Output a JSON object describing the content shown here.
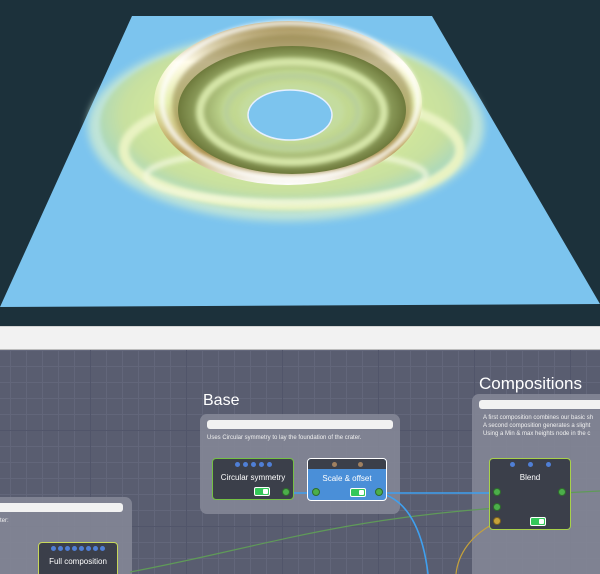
{
  "graph": {
    "groups": {
      "base": {
        "title": "Base",
        "description": "Uses Circular symmetry to lay the foundation of the crater."
      },
      "compositions": {
        "title": "Compositions",
        "description_lines": [
          "A first composition combines our basic sh",
          "A second composition generates a slight",
          "Using a Min & max heights node in the c"
        ]
      },
      "left": {
        "description": "ter:"
      }
    },
    "nodes": {
      "circular_symmetry": {
        "title": "Circular symmetry"
      },
      "scale_offset": {
        "title": "Scale & offset"
      },
      "blend": {
        "title": "Blend"
      },
      "full_composition": {
        "title": "Full composition"
      }
    },
    "colors": {
      "wire_blue": "#3fa0ef",
      "wire_green": "#5f9a58",
      "wire_amber": "#c6a23a",
      "node_border": "#74c044",
      "selected_node_border": "#ffffff",
      "node_blue": "#4a8fd8"
    }
  },
  "preview": {
    "plane_color": "#7cc4ee",
    "background": "#1c313b"
  }
}
